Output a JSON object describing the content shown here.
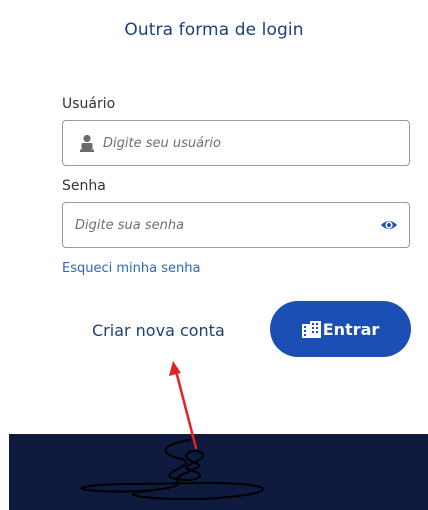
{
  "header": {
    "title": "Outra forma de login"
  },
  "form": {
    "user_label": "Usuário",
    "user_placeholder": "Digite seu usuário",
    "password_label": "Senha",
    "password_placeholder": "Digite sua senha",
    "forgot_label": "Esqueci minha senha"
  },
  "actions": {
    "create_label": "Criar nova conta",
    "enter_label": "Entrar"
  },
  "icons": {
    "user": "user-icon",
    "eye": "eye-icon",
    "enter": "building-icon"
  },
  "colors": {
    "title": "#1f3f7a",
    "link": "#2a6ab8",
    "primary_button": "#1c4fb3",
    "footer": "#0f1a3f",
    "annotation_arrow": "#e02424"
  }
}
